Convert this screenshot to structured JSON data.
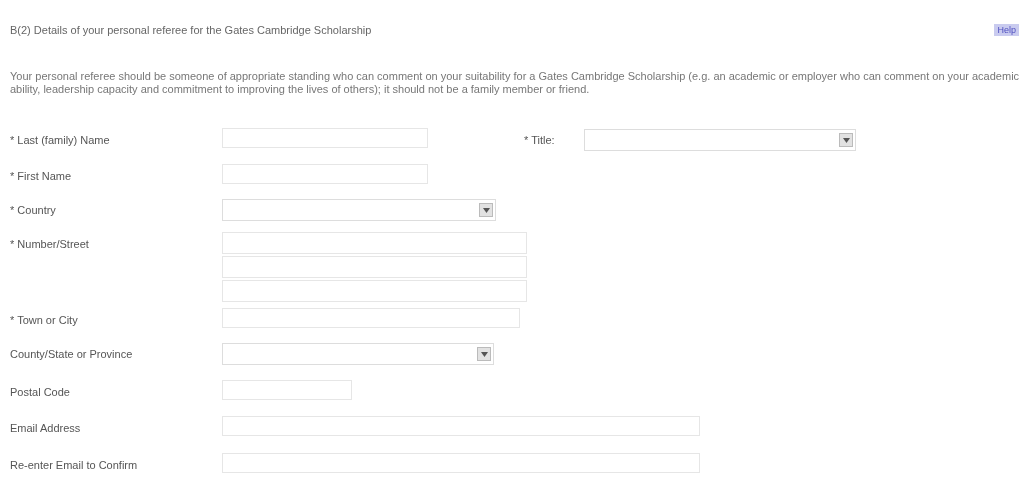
{
  "section_title": "B(2) Details of your personal referee for the Gates Cambridge Scholarship",
  "help_link": "Help",
  "intro": "Your personal referee should be someone of appropriate standing who can comment on your suitability for a Gates Cambridge Scholarship (e.g. an academic or employer who can comment on your academic ability, leadership capacity and commitment to improving the lives of others); it should not be a family member or friend.",
  "fields": [
    {
      "label": "* Last (family) Name",
      "kind": "text",
      "side": {
        "label": "* Title:",
        "kind": "select"
      }
    },
    {
      "label": "* First Name",
      "kind": "text"
    },
    {
      "label": "* Country",
      "kind": "select"
    },
    {
      "label": "* Number/Street",
      "kind": "address"
    },
    {
      "label": "* Town or City",
      "kind": "text"
    },
    {
      "label": "County/State or Province",
      "kind": "select"
    },
    {
      "label": "Postal Code",
      "kind": "text"
    },
    {
      "label": "Email Address",
      "kind": "text"
    },
    {
      "label": "Re-enter Email to Confirm",
      "kind": "text"
    }
  ]
}
